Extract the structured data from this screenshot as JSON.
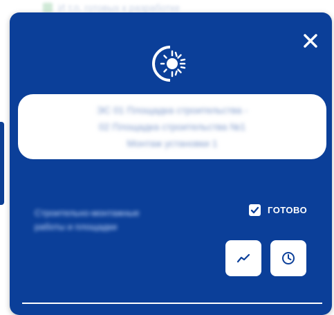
{
  "background": {
    "hint_text": "И т.п. готовых к разработке"
  },
  "modal": {
    "close_icon": "close-icon",
    "logo_icon": "company-logo-icon",
    "title_lines": [
      "ЭС 01 Площадка строительства -",
      "02 Площадка строительства №1",
      "Монтаж установки 1"
    ],
    "description_lines": [
      "Строительно-монтажные",
      "работы и площадки"
    ],
    "status": {
      "checked": true,
      "label": "ГОТОВО"
    },
    "actions": {
      "chart_icon": "trend-chart-icon",
      "history_icon": "clock-icon"
    }
  },
  "colors": {
    "modal_bg": "#0b3f99",
    "card_bg": "#ffffff",
    "text_on_dark": "#ffffff",
    "icon_color": "#0b3f99"
  }
}
